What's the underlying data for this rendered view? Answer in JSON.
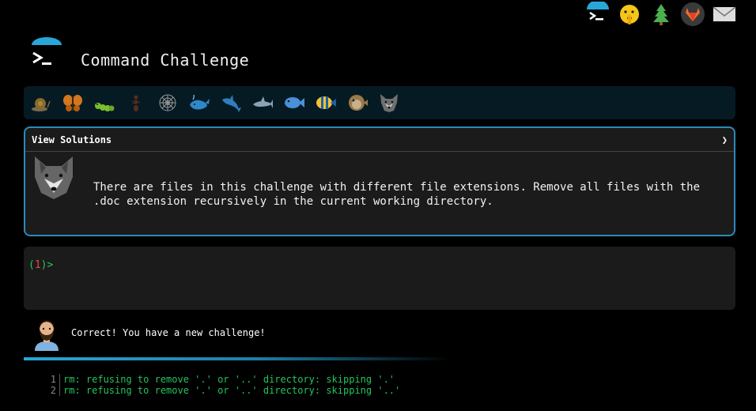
{
  "header": {
    "title": "Command Challenge"
  },
  "top_icons": [
    "terminal-icon",
    "shushing-face-icon",
    "tree-icon",
    "gitlab-icon",
    "mail-icon"
  ],
  "animals": [
    "snail-icon",
    "butterfly-icon",
    "caterpillar-icon",
    "ant-icon",
    "spider-web-icon",
    "whale-icon",
    "dolphin-icon",
    "shark-icon",
    "fish-icon",
    "tropical-fish-icon",
    "blowfish-icon",
    "wolf-icon"
  ],
  "challenge": {
    "solutions_label": "View Solutions",
    "chevron": "❯",
    "description": "There are files in this challenge with different file extensions. Remove all files with the .doc extension recursively in the current working directory."
  },
  "terminal": {
    "prompt_open": "(",
    "prompt_number": "1",
    "prompt_close": ")>"
  },
  "result": {
    "message": "Correct! You have a new challenge!"
  },
  "output": [
    {
      "num": "1",
      "text": "rm: refusing to remove '.' or '..' directory: skipping '.'"
    },
    {
      "num": "2",
      "text": "rm: refusing to remove '.' or '..' directory: skipping '..'"
    }
  ],
  "colors": {
    "accent": "#2a8bb8",
    "prompt_green": "#22c55e",
    "prompt_red": "#ef4444",
    "panel": "#1b1b1b"
  }
}
